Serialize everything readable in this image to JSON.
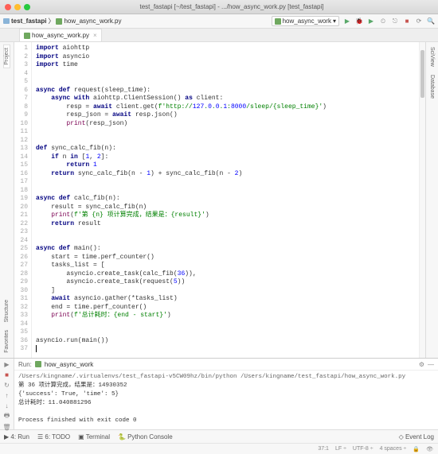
{
  "title": "test_fastapi [~/test_fastapi] - .../how_async_work.py [test_fastapi]",
  "toolbar": {
    "project": "test_fastapi",
    "file": "how_async_work.py",
    "config": "how_async_work"
  },
  "tab": {
    "name": "how_async_work.py"
  },
  "sidetabs": {
    "left": [
      "Project",
      "Structure",
      "Favorites"
    ],
    "right": [
      "SciView",
      "Database"
    ]
  },
  "code": {
    "lines": [
      {
        "n": 1,
        "t": "import aiohttp",
        "kind": "import"
      },
      {
        "n": 2,
        "t": "import asyncio",
        "kind": "import"
      },
      {
        "n": 3,
        "t": "import time",
        "kind": "import"
      },
      {
        "n": 4,
        "t": ""
      },
      {
        "n": 5,
        "t": ""
      },
      {
        "n": 6,
        "t": "async def request(sleep_time):",
        "kind": "def"
      },
      {
        "n": 7,
        "t": "    async with aiohttp.ClientSession() as client:",
        "kind": "with"
      },
      {
        "n": 8,
        "t": "        resp = await client.get(f'http://127.0.0.1:8000/sleep/{sleep_time}')",
        "kind": "await_str"
      },
      {
        "n": 9,
        "t": "        resp_json = await resp.json()",
        "kind": "await"
      },
      {
        "n": 10,
        "t": "        print(resp_json)",
        "kind": "call"
      },
      {
        "n": 11,
        "t": ""
      },
      {
        "n": 12,
        "t": ""
      },
      {
        "n": 13,
        "t": "def sync_calc_fib(n):",
        "kind": "def2"
      },
      {
        "n": 14,
        "t": "    if n in [1, 2]:",
        "kind": "if"
      },
      {
        "n": 15,
        "t": "        return 1",
        "kind": "ret"
      },
      {
        "n": 16,
        "t": "    return sync_calc_fib(n - 1) + sync_calc_fib(n - 2)",
        "kind": "ret2"
      },
      {
        "n": 17,
        "t": ""
      },
      {
        "n": 18,
        "t": ""
      },
      {
        "n": 19,
        "t": "async def calc_fib(n):",
        "kind": "def"
      },
      {
        "n": 20,
        "t": "    result = sync_calc_fib(n)"
      },
      {
        "n": 21,
        "t": "    print(f'第 {n} 项计算完成，结果是：{result}')",
        "kind": "print_str"
      },
      {
        "n": 22,
        "t": "    return result",
        "kind": "ret3"
      },
      {
        "n": 23,
        "t": ""
      },
      {
        "n": 24,
        "t": ""
      },
      {
        "n": 25,
        "t": "async def main():",
        "kind": "def"
      },
      {
        "n": 26,
        "t": "    start = time.perf_counter()"
      },
      {
        "n": 27,
        "t": "    tasks_list = ["
      },
      {
        "n": 28,
        "t": "        asyncio.create_task(calc_fib(36)),",
        "kind": "num"
      },
      {
        "n": 29,
        "t": "        asyncio.create_task(request(5))",
        "kind": "num"
      },
      {
        "n": 30,
        "t": "    ]"
      },
      {
        "n": 31,
        "t": "    await asyncio.gather(*tasks_list)",
        "kind": "await"
      },
      {
        "n": 32,
        "t": "    end = time.perf_counter()"
      },
      {
        "n": 33,
        "t": "    print(f'总计耗时：{end - start}')",
        "kind": "print_str"
      },
      {
        "n": 34,
        "t": ""
      },
      {
        "n": 35,
        "t": ""
      },
      {
        "n": 36,
        "t": "asyncio.run(main())"
      },
      {
        "n": 37,
        "t": ""
      }
    ]
  },
  "run": {
    "label": "Run:",
    "tab": "how_async_work",
    "output": [
      "/Users/kingname/.virtualenvs/test_fastapi-v5CW09hz/bin/python /Users/kingname/test_fastapi/how_async_work.py",
      "第 36 项计算完成，结果是：14930352",
      "{'success': True, 'time': 5}",
      "总计耗时：11.040881296",
      "",
      "Process finished with exit code 0"
    ]
  },
  "bottom": {
    "run": "Run",
    "todo": "TODO",
    "terminal": "Terminal",
    "python_console": "Python Console",
    "event_log": "Event Log"
  },
  "status": {
    "pos": "37:1",
    "lf": "LF",
    "enc": "UTF-8",
    "indent": "4 spaces"
  }
}
